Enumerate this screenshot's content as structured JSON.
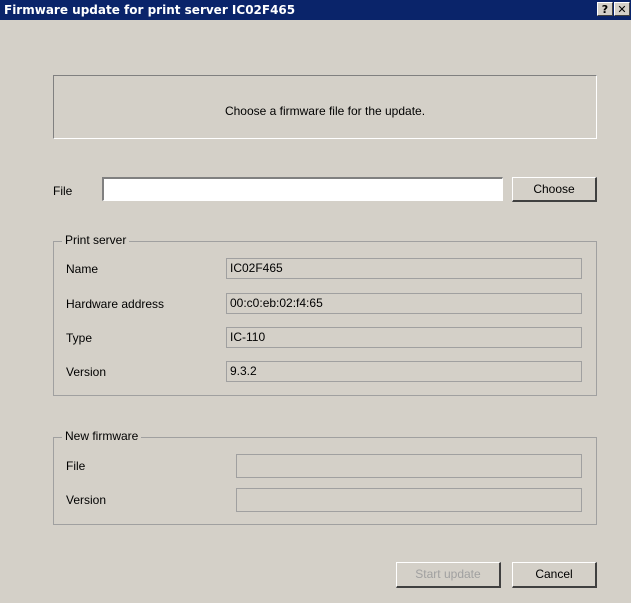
{
  "window": {
    "title": "Firmware update for print server IC02F465",
    "help_glyph": "?",
    "close_glyph": "✕"
  },
  "info": {
    "message": "Choose a firmware file for the update."
  },
  "file_row": {
    "label": "File",
    "value": "",
    "choose_label": "Choose"
  },
  "print_server": {
    "legend": "Print server",
    "rows": [
      {
        "label": "Name",
        "value": "IC02F465"
      },
      {
        "label": "Hardware address",
        "value": "00:c0:eb:02:f4:65"
      },
      {
        "label": "Type",
        "value": "IC-110"
      },
      {
        "label": "Version",
        "value": "9.3.2"
      }
    ]
  },
  "new_firmware": {
    "legend": "New firmware",
    "rows": [
      {
        "label": "File",
        "value": ""
      },
      {
        "label": "Version",
        "value": ""
      }
    ]
  },
  "buttons": {
    "start_update": "Start update",
    "cancel": "Cancel"
  }
}
